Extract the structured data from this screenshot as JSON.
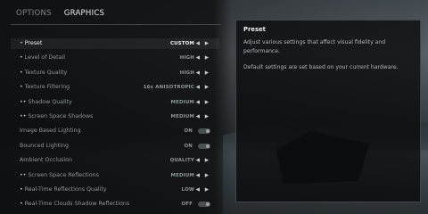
{
  "tabs": [
    {
      "label": "OPTIONS",
      "active": false
    },
    {
      "label": "GRAPHICS",
      "active": true
    }
  ],
  "settings": [
    {
      "label": "Preset",
      "marker": "•",
      "value": "CUSTOM",
      "control": "arrows",
      "selected": true
    },
    {
      "label": "Level of Detail",
      "marker": "•",
      "value": "HIGH",
      "control": "arrows"
    },
    {
      "label": "Texture Quality",
      "marker": "•",
      "value": "HIGH",
      "control": "arrows"
    },
    {
      "label": "Texture Filtering",
      "marker": "•",
      "value": "16x ANISOTROPIC",
      "control": "arrows"
    },
    {
      "label": "Shadow Quality",
      "marker": "••",
      "value": "MEDIUM",
      "control": "arrows"
    },
    {
      "label": "Screen Space Shadows",
      "marker": "••",
      "value": "MEDIUM",
      "control": "arrows"
    },
    {
      "label": "Image Based Lighting",
      "marker": "",
      "value": "ON",
      "control": "toggle"
    },
    {
      "label": "Bounced Lighting",
      "marker": "",
      "value": "ON",
      "control": "toggle"
    },
    {
      "label": "Ambient Occlusion",
      "marker": "",
      "value": "QUALITY",
      "control": "arrows"
    },
    {
      "label": "Screen Space Reflections",
      "marker": "••",
      "value": "MEDIUM",
      "control": "arrows"
    },
    {
      "label": "Real-Time Reflections Quality",
      "marker": "•",
      "value": "LOW",
      "control": "arrows"
    },
    {
      "label": "Real-Time Clouds Shadow Reflections",
      "marker": "•",
      "value": "OFF",
      "control": "toggle"
    }
  ],
  "panel": {
    "title": "Preset",
    "paragraph1": "Adjust various settings that affect visual fidelity and performance.",
    "paragraph2": "Default settings are set based on your current hardware."
  },
  "icons": {
    "arrows": "◀ ▶",
    "marker": "•"
  },
  "colors": {
    "accent": "#e9ebec",
    "muted": "#8f9699",
    "panel_bg": "#0a0c0d"
  }
}
